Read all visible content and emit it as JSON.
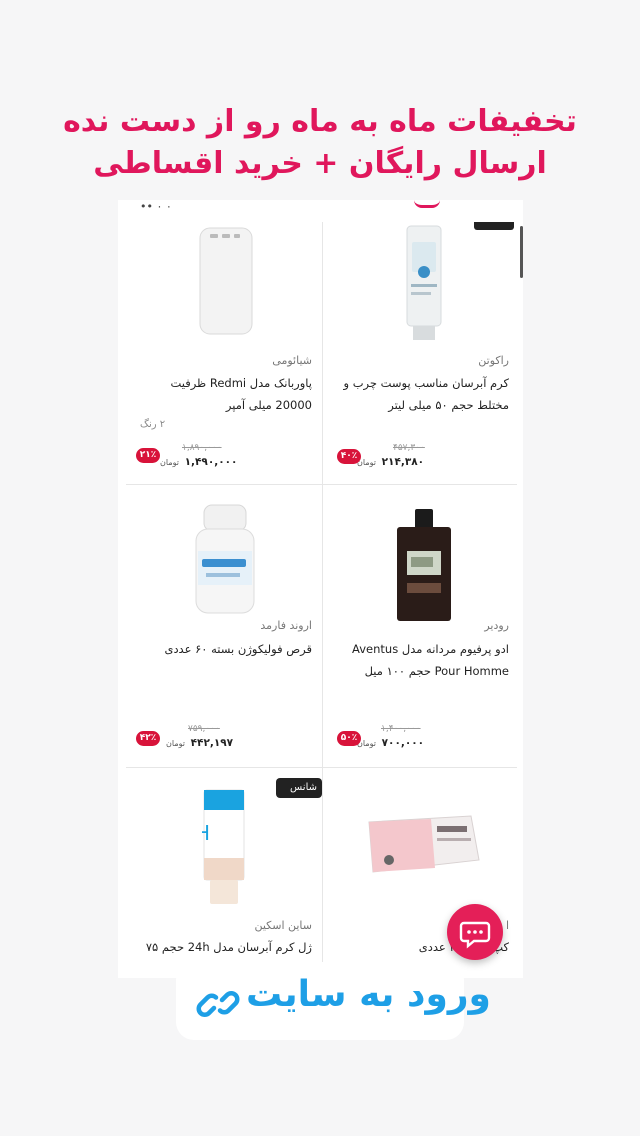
{
  "headline": {
    "line1": "تخفیفات ماه به ماه رو از دست نده",
    "line2": "ارسال رایگان + خرید اقساطی"
  },
  "top_strip": {
    "dots": "•• ٠ ٠"
  },
  "products": [
    {
      "brand": "راکوتن",
      "title": "کرم آبرسان مناسب پوست چرب و مختلط حجم ۵۰ میلی لیتر",
      "old_price": "۴۵۷,۳۰۰",
      "price": "۲۱۴,۳۸۰",
      "currency": "تومان",
      "discount": "۴۰٪"
    },
    {
      "brand": "شیائومی",
      "title": "پاوربانک مدل Redmi ظرفیت 20000 میلی آمپر",
      "colors": "۲ رنگ",
      "old_price": "۱,۸۹۰,۰۰۰",
      "price": "۱,۴۹۰,۰۰۰",
      "currency": "تومان",
      "discount": "۲۱٪"
    },
    {
      "brand": "رودیر",
      "title": "ادو پرفیوم مردانه مدل Aventus Pour Homme حجم ۱۰۰ میل",
      "old_price": "۱,۴۰۰,۰۰۰",
      "price": "۷۰۰,۰۰۰",
      "currency": "تومان",
      "discount": "۵۰٪"
    },
    {
      "brand": "اروند فارمد",
      "title": "قرص فولیکوژن بسته ۶۰ عددی",
      "old_price": "۷۵۹,۰۰۰",
      "price": "۴۴۲,۱۹۷",
      "currency": "تومان",
      "discount": "۴۲٪"
    },
    {
      "brand": "ا",
      "title": "کپ بسته ۳۰ عددی"
    },
    {
      "brand": "ساین اسکین",
      "title": "ژل کرم آبرسان مدل 24h حجم ۷۵",
      "badge": "شانس"
    }
  ],
  "chat": {
    "icon": "chat-bubble-icon"
  },
  "login": {
    "label": "ورود به سایت",
    "icon": "link-icon"
  },
  "colors": {
    "accent": "#e0175c",
    "discount": "#d8133a",
    "login": "#1e9fe6",
    "chat": "#e41f58"
  }
}
